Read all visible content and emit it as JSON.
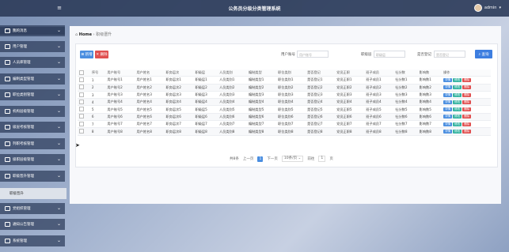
{
  "app": {
    "title": "公务员分级分类管理系统",
    "user": "admin",
    "user_caret": "▾"
  },
  "sidebar": {
    "first_label": "首页",
    "items": [
      {
        "label": "我的消息"
      },
      {
        "label": "用户管理"
      },
      {
        "label": "人员库管理"
      },
      {
        "label": "编制类型管理"
      },
      {
        "label": "职位类别管理"
      },
      {
        "label": "机构层级管理"
      },
      {
        "label": "级层考核管理"
      },
      {
        "label": "列职考核管理"
      },
      {
        "label": "级职层级管理"
      },
      {
        "label": "职级晋升管理"
      },
      {
        "label": "党组织管理"
      },
      {
        "label": "通知公告管理"
      },
      {
        "label": "系统管理"
      }
    ],
    "sub_item": "职级晋升",
    "chevron": "⌄"
  },
  "breadcrumb": {
    "home": "Home",
    "sep": "›",
    "current": "职级晋升"
  },
  "toolbar": {
    "add_label": "新增",
    "delete_label": "删除",
    "search_button": "查询"
  },
  "search": {
    "fields": [
      {
        "label": "用户账号",
        "placeholder": "用户账号"
      },
      {
        "label": "职级层",
        "placeholder": "职级层"
      },
      {
        "label": "是否登记",
        "placeholder": "是否登记"
      }
    ]
  },
  "table": {
    "headers": [
      "序号",
      "用户账号",
      "用户姓名",
      "职务层次",
      "职级层",
      "人员类别",
      "编制类型",
      "职位类别",
      "是否登记",
      "党员正职",
      "班子成员",
      "社分数",
      "影响数",
      "操作"
    ],
    "rows": [
      [
        "1",
        "用户账号1",
        "用户姓名1",
        "职务层次1",
        "职级层1",
        "人员类别1",
        "编制类型1",
        "职位类别1",
        "是否登记1",
        "党员正职1",
        "班子成员1",
        "社分数1",
        "影响数1"
      ],
      [
        "2",
        "用户账号2",
        "用户姓名2",
        "职务层次2",
        "职级层2",
        "人员类别2",
        "编制类型2",
        "职位类别2",
        "是否登记2",
        "党员正职2",
        "班子成员2",
        "社分数2",
        "影响数2"
      ],
      [
        "3",
        "用户账号3",
        "用户姓名3",
        "职务层次3",
        "职级层3",
        "人员类别3",
        "编制类型3",
        "职位类别3",
        "是否登记3",
        "党员正职3",
        "班子成员3",
        "社分数3",
        "影响数3"
      ],
      [
        "4",
        "用户账号4",
        "用户姓名4",
        "职务层次4",
        "职级层4",
        "人员类别4",
        "编制类型4",
        "职位类别4",
        "是否登记4",
        "党员正职4",
        "班子成员4",
        "社分数4",
        "影响数4"
      ],
      [
        "5",
        "用户账号5",
        "用户姓名5",
        "职务层次5",
        "职级层5",
        "人员类别5",
        "编制类型5",
        "职位类别5",
        "是否登记5",
        "党员正职5",
        "班子成员5",
        "社分数5",
        "影响数5"
      ],
      [
        "6",
        "用户账号6",
        "用户姓名6",
        "职务层次6",
        "职级层6",
        "人员类别6",
        "编制类型6",
        "职位类别6",
        "是否登记6",
        "党员正职6",
        "班子成员6",
        "社分数6",
        "影响数6"
      ],
      [
        "7",
        "用户账号7",
        "用户姓名7",
        "职务层次7",
        "职级层7",
        "人员类别7",
        "编制类型7",
        "职位类别7",
        "是否登记7",
        "党员正职7",
        "班子成员7",
        "社分数7",
        "影响数7"
      ],
      [
        "8",
        "用户账号8",
        "用户姓名8",
        "职务层次8",
        "职级层8",
        "人员类别8",
        "编制类型8",
        "职位类别8",
        "是否登记8",
        "党员正职8",
        "班子成员8",
        "社分数8",
        "影响数8"
      ]
    ],
    "ops": {
      "detail": "详情",
      "edit": "修改",
      "delete": "删除"
    }
  },
  "pager": {
    "total": "共8条",
    "prev": "上一页",
    "current": "1",
    "next": "下一页",
    "page_size": "10条/页",
    "goto_label": "前往",
    "goto_value": "1",
    "page_unit": "页"
  },
  "colors": {
    "topbar": "#2f3e5c",
    "primary": "#4a8ee0",
    "danger": "#e05050",
    "success": "#34b3a0"
  }
}
